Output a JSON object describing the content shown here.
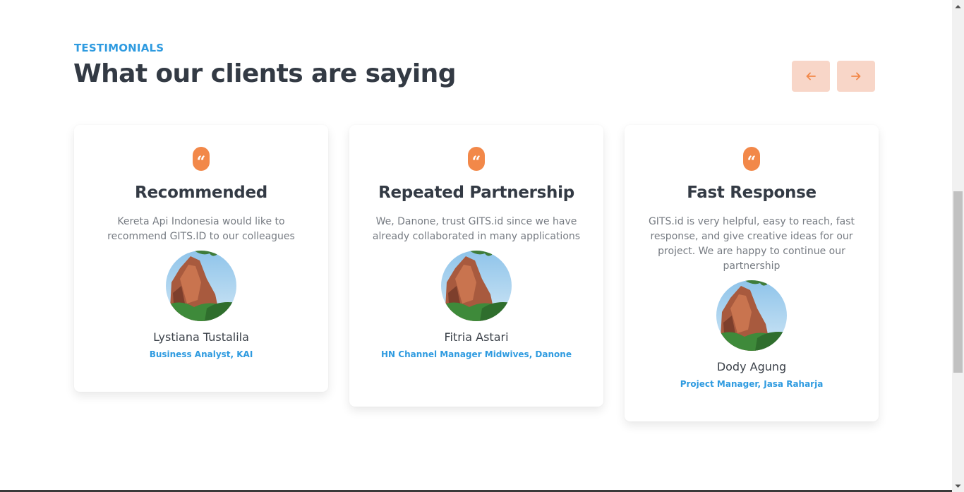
{
  "section": {
    "eyebrow": "TESTIMONIALS",
    "heading": "What our clients are saying"
  },
  "nav": {
    "prev_icon": "arrow-left-icon",
    "next_icon": "arrow-right-icon"
  },
  "testimonials": [
    {
      "quote_icon": "quote-icon",
      "title": "Recommended",
      "text": "Kereta Api Indonesia would like to recommend GITS.ID to our colleagues",
      "name": "Lystiana Tustalila",
      "role": "Business Analyst, KAI"
    },
    {
      "quote_icon": "quote-icon",
      "title": "Repeated Partnership",
      "text": "We, Danone, trust GITS.id since we have already collaborated in many applications",
      "name": "Fitria Astari",
      "role": "HN Channel Manager Midwives, Danone"
    },
    {
      "quote_icon": "quote-icon",
      "title": "Fast Response",
      "text": "GITS.id is very helpful, easy to reach, fast response, and give creative ideas for our project. We are happy to continue our partnership",
      "name": "Dody Agung",
      "role": "Project Manager, Jasa Raharja"
    }
  ],
  "colors": {
    "accent_blue": "#2f9be0",
    "accent_orange": "#f28849",
    "nav_button_bg": "#f8d6c8",
    "heading": "#333a44",
    "body_text": "#767b82"
  }
}
